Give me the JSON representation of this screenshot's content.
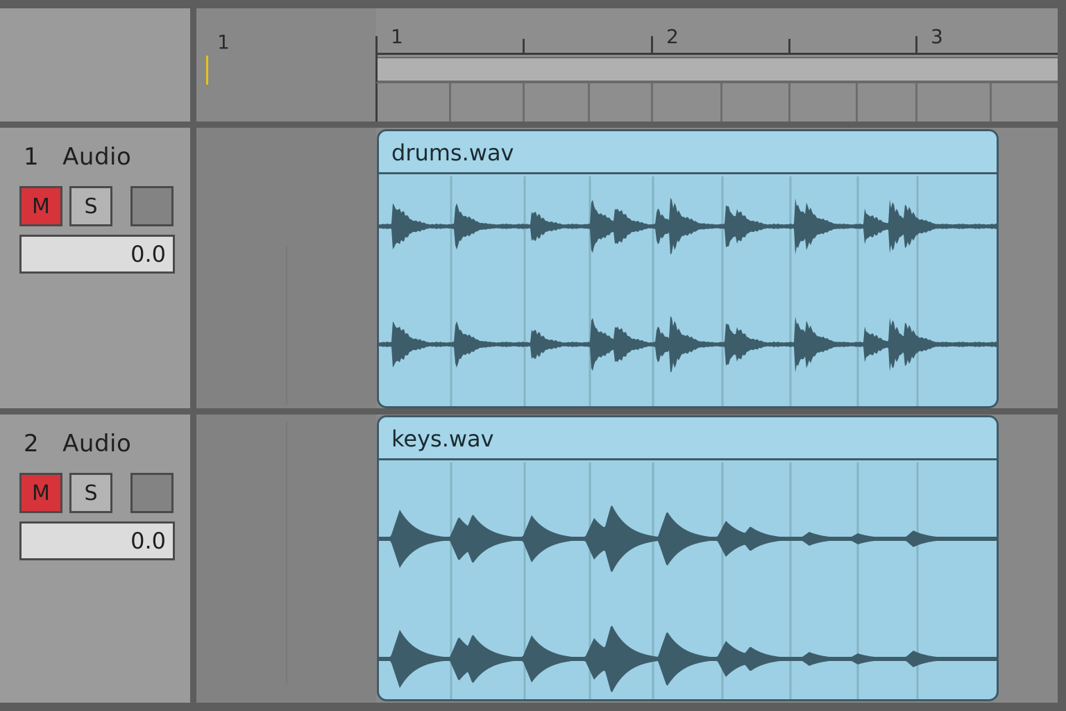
{
  "ruler": {
    "pre_bar_label": "1",
    "bar_labels": [
      "1",
      "2",
      "3"
    ]
  },
  "tracks": [
    {
      "number": "1",
      "name": "Audio",
      "mute_label": "M",
      "solo_label": "S",
      "mute_active": true,
      "volume": "0.0",
      "clip": {
        "name": "drums.wav",
        "color": "#9dd0e4"
      }
    },
    {
      "number": "2",
      "name": "Audio",
      "mute_label": "M",
      "solo_label": "S",
      "mute_active": true,
      "volume": "0.0",
      "clip": {
        "name": "keys.wav",
        "color": "#9dd0e4"
      }
    }
  ],
  "colors": {
    "mute_active": "#d6333b",
    "clip": "#9dd0e4",
    "waveform": "#3d5d6b",
    "cue_marker": "#e6c21a"
  }
}
